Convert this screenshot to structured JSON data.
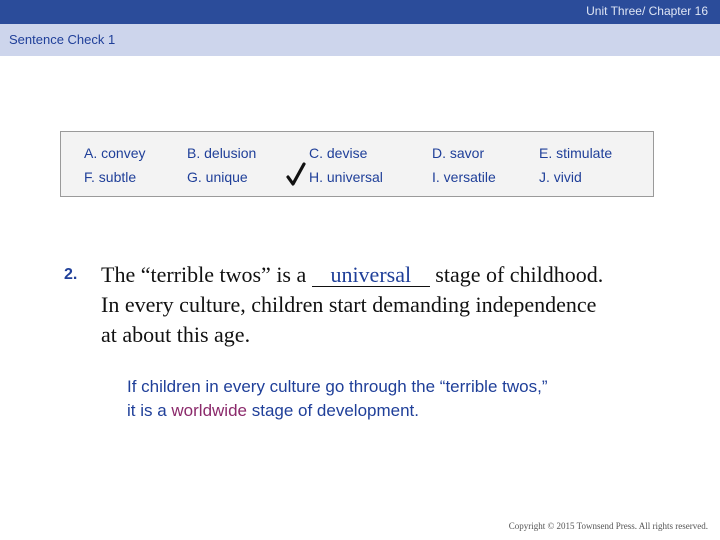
{
  "header": {
    "chapter": "Unit Three/ Chapter 16"
  },
  "section": {
    "title": "Sentence Check 1"
  },
  "word_bank": [
    {
      "letter": "A.",
      "word": "convey"
    },
    {
      "letter": "F.",
      "word": "subtle"
    },
    {
      "letter": "B.",
      "word": "delusion"
    },
    {
      "letter": "G.",
      "word": "unique"
    },
    {
      "letter": "C.",
      "word": "devise"
    },
    {
      "letter": "H.",
      "word": "universal"
    },
    {
      "letter": "D.",
      "word": "savor"
    },
    {
      "letter": "I.",
      "word": "versatile"
    },
    {
      "letter": "E.",
      "word": "stimulate"
    },
    {
      "letter": "J.",
      "word": "vivid"
    }
  ],
  "question": {
    "number": "2.",
    "line1_before": "The “terrible twos” is a ",
    "answer": "universal",
    "line1_after": " stage of childhood.",
    "line2": "In every culture, children start demanding independence",
    "line3": "at about this age."
  },
  "hint": {
    "line1": "If children in every culture go through the “terrible twos,”",
    "line2_before": "it is a ",
    "line2_highlight": "worldwide",
    "line2_after": " stage of development."
  },
  "footer": {
    "copyright": "Copyright © 2015 Townsend Press. All rights reserved."
  },
  "colors": {
    "accent": "#1f3f99",
    "topbar": "#2b4c9a",
    "subbar": "#cdd5ec",
    "highlight": "#8b2a6b"
  }
}
